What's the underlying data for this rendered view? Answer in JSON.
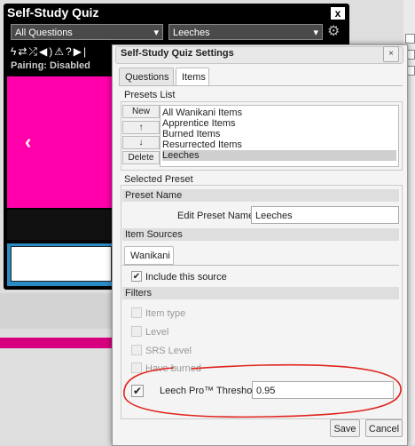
{
  "quiz": {
    "title": "Self-Study Quiz",
    "close": "x",
    "filter_select": "All Questions",
    "preset_select": "Leeches",
    "pairing_status": "Pairing: Disabled",
    "prev_glyph": "‹"
  },
  "dialog": {
    "title": "Self-Study Quiz Settings",
    "close": "×",
    "tabs": [
      "Questions",
      "Items"
    ],
    "presets_list_title": "Presets List",
    "buttons": {
      "new": "New",
      "up": "↑",
      "down": "↓",
      "delete": "Delete"
    },
    "presets": [
      "All Wanikani Items",
      "Apprentice Items",
      "Burned Items",
      "Resurrected Items",
      "Leeches"
    ],
    "selected_preset_title": "Selected Preset",
    "preset_name_band": "Preset Name",
    "edit_preset_label": "Edit Preset Name",
    "edit_preset_value": "Leeches",
    "item_sources_band": "Item Sources",
    "source_tab": "Wanikani",
    "include_source_label": "Include this source",
    "filters_band": "Filters",
    "filters": [
      "Item type",
      "Level",
      "SRS Level",
      "Have burned"
    ],
    "leech_label": "Leech Pro™ Threshold",
    "leech_value": "0.95",
    "save": "Save",
    "cancel": "Cancel"
  },
  "colors": {
    "accent_pink": "#ff00aa",
    "annotation_red": "#e0241d"
  }
}
